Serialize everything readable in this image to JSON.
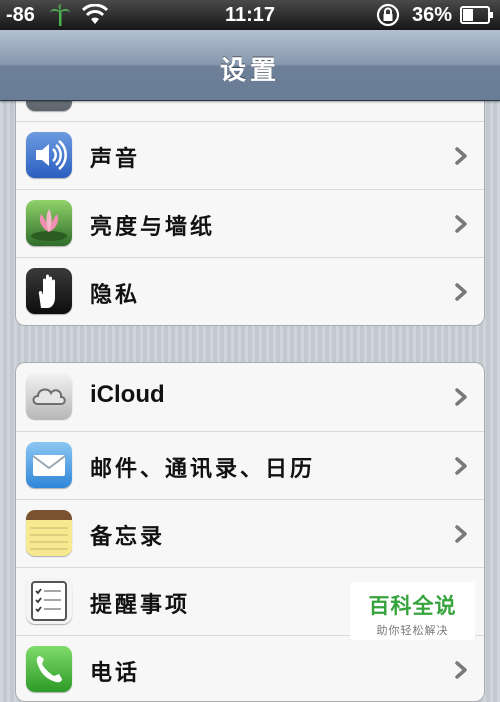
{
  "status_bar": {
    "signal": "-86",
    "time": "11:17",
    "battery": "36%"
  },
  "nav": {
    "title": "设置"
  },
  "groups": [
    {
      "rows": [
        {
          "label": "声音",
          "icon": "sound-icon"
        },
        {
          "label": "亮度与墙纸",
          "icon": "wallpaper-icon"
        },
        {
          "label": "隐私",
          "icon": "privacy-hand-icon"
        }
      ]
    },
    {
      "rows": [
        {
          "label": "iCloud",
          "icon": "icloud-icon"
        },
        {
          "label": "邮件、通讯录、日历",
          "icon": "mail-icon"
        },
        {
          "label": "备忘录",
          "icon": "notes-icon"
        },
        {
          "label": "提醒事项",
          "icon": "reminders-icon"
        },
        {
          "label": "电话",
          "icon": "phone-icon"
        }
      ]
    }
  ],
  "watermark": {
    "title": "百科全说",
    "subtitle": "助你轻松解决"
  }
}
